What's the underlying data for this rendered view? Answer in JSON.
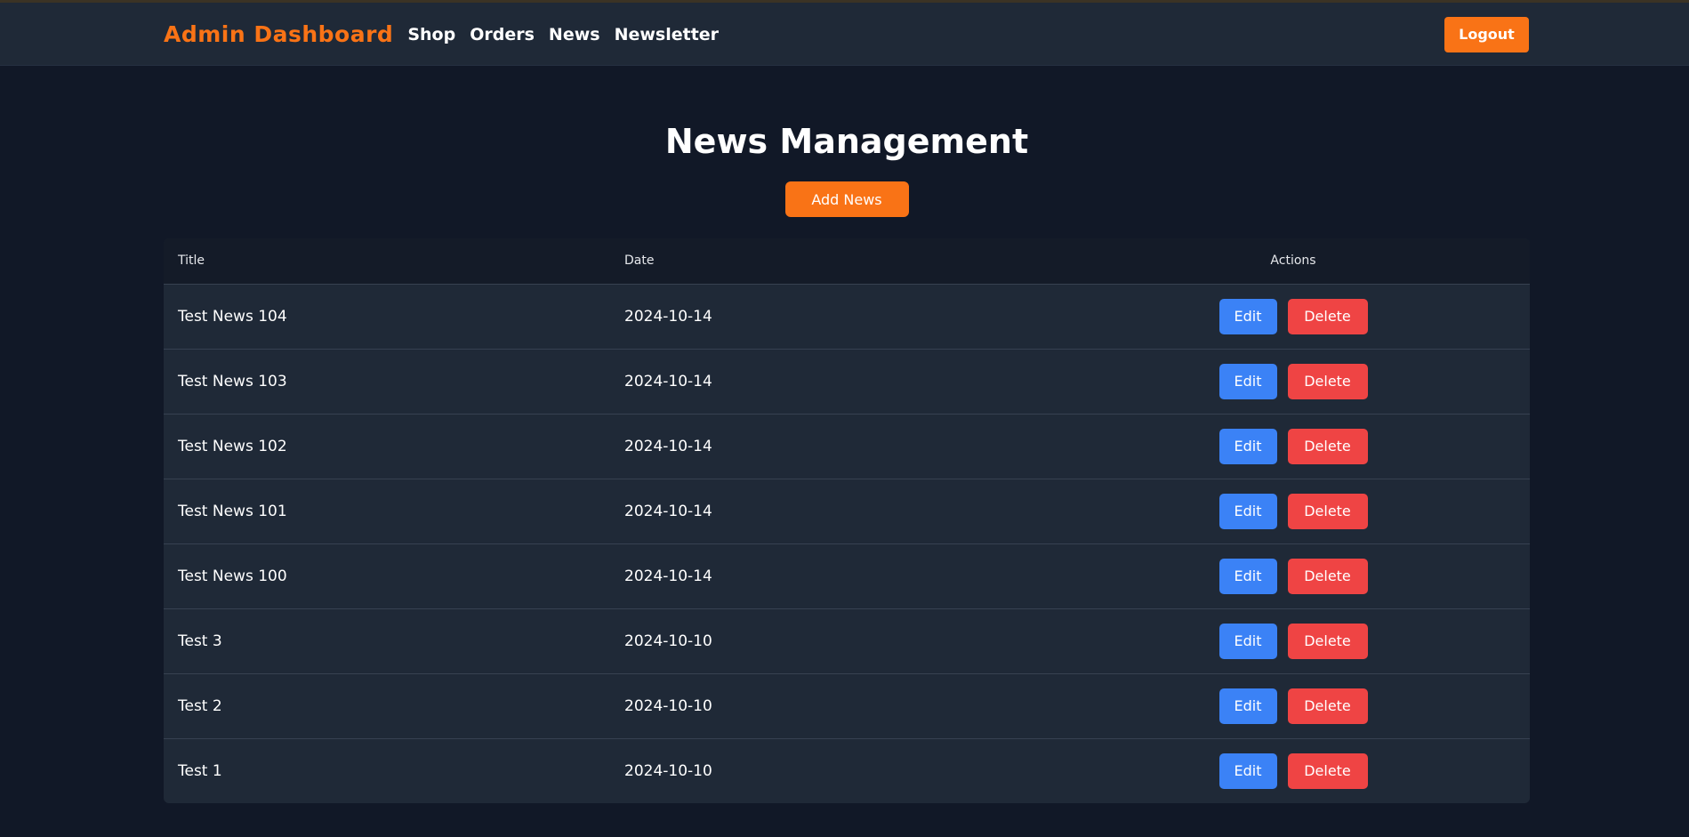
{
  "header": {
    "brand": "Admin Dashboard",
    "nav": [
      "Shop",
      "Orders",
      "News",
      "Newsletter"
    ],
    "logout_label": "Logout"
  },
  "main": {
    "title": "News Management",
    "add_label": "Add News",
    "columns": {
      "title": "Title",
      "date": "Date",
      "actions": "Actions"
    },
    "rows": [
      {
        "title": "Test News 104",
        "date": "2024-10-14"
      },
      {
        "title": "Test News 103",
        "date": "2024-10-14"
      },
      {
        "title": "Test News 102",
        "date": "2024-10-14"
      },
      {
        "title": "Test News 101",
        "date": "2024-10-14"
      },
      {
        "title": "Test News 100",
        "date": "2024-10-14"
      },
      {
        "title": "Test 3",
        "date": "2024-10-10"
      },
      {
        "title": "Test 2",
        "date": "2024-10-10"
      },
      {
        "title": "Test 1",
        "date": "2024-10-10"
      }
    ],
    "edit_label": "Edit",
    "delete_label": "Delete"
  },
  "colors": {
    "background": "#111827",
    "navbar": "#1f2937",
    "accent": "#f97316",
    "edit": "#3b82f6",
    "delete": "#ef4444"
  }
}
